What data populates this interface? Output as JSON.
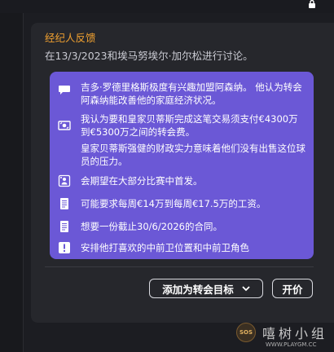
{
  "card": {
    "title": "经纪人反馈",
    "subtitle": "在13/3/2023和埃马努埃尔·加尔松进行讨论。"
  },
  "feedback_items": [
    {
      "icon": "chat-bubble-icon",
      "text": "吉多·罗德里格斯极度有兴趣加盟阿森纳。 他认为转会阿森纳能改善他的家庭经济状况。"
    },
    {
      "icon": "money-transfer-icon",
      "text": "我认为要和皇家贝蒂斯完成这笔交易须支付€4300万到€5300万之间的转会费。"
    },
    {
      "icon": "",
      "text": "皇家贝蒂斯强健的财政实力意味着他们没有出售这位球员的压力。"
    },
    {
      "icon": "player-lineup-icon",
      "text": "会期望在大部分比赛中首发。"
    },
    {
      "icon": "contract-document-icon",
      "text": "可能要求每周€14万到每周€17.5万的工资。"
    },
    {
      "icon": "contract-document-icon",
      "text": "想要一份截止30/6/2026的合同。"
    },
    {
      "icon": "exclamation-icon",
      "text": "安排他打喜欢的中前卫位置和中前卫角色"
    }
  ],
  "buttons": {
    "add_target": "添加为转会目标",
    "offer": "开价"
  },
  "watermark": {
    "badge": "SOS",
    "main": "嘻树小组",
    "url": "WWW.PLAYGM.CC"
  },
  "colors": {
    "accent_orange": "#f0a030",
    "panel_purple": "#6b58d6",
    "card_bg": "#26272c"
  }
}
